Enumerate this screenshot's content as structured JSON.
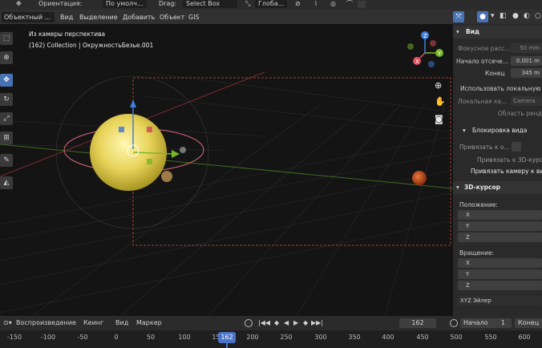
{
  "topbar": {
    "orientation_label": "Ориентация:",
    "orientation_value": "По умолч...",
    "drag_label": "Drag:",
    "drag_value": "Select Box",
    "transform_value": "Глоба..."
  },
  "header": {
    "mode": "Объектный ...",
    "menus": [
      "Вид",
      "Выделение",
      "Добавить",
      "Объект",
      "GIS"
    ]
  },
  "viewport": {
    "camera_text": "Из камеры перспектива",
    "collection_text": "(162) Collection | ОкружностьБезье.001",
    "gizmo": {
      "z": "Z",
      "y": "Y",
      "x": "X"
    }
  },
  "sidebar": {
    "view_panel": {
      "title": "Вид",
      "focal_label": "Фокусное расс...",
      "focal_value": "50 mm",
      "clip_start_label": "Начало отсече...",
      "clip_start_value": "0.001 m",
      "clip_end_label": "Конец",
      "clip_end_value": "345 m",
      "use_local_camera": "Использовать локальную к...",
      "local_camera_label": "Локальная ка...",
      "local_camera_value": "Camera",
      "render_region": "Область рендера"
    },
    "lock_panel": {
      "title": "Блокировка вида",
      "lock_to_object": "Привязать к о...",
      "lock_to_cursor": "Привязать к 3D-курсору",
      "lock_camera_to_view": "Привязать камеру к вид..."
    },
    "cursor_panel": {
      "title": "3D-курсор",
      "location_label": "Положение:",
      "rotation_label": "Вращение:",
      "axes": [
        "X",
        "Y",
        "Z"
      ],
      "euler_mode": "XYZ Эйлер"
    }
  },
  "playback": {
    "menus": [
      "Воспроизведение",
      "Кеинг",
      "Вид",
      "Маркер"
    ],
    "current_frame": "162",
    "start_label": "Начало",
    "start_value": "1",
    "end_label": "Конец"
  },
  "timeline": {
    "ticks": [
      "-150",
      "-100",
      "-50",
      "0",
      "50",
      "100",
      "150",
      "200",
      "250",
      "300",
      "350",
      "400",
      "450",
      "500",
      "550",
      "600"
    ],
    "current_frame": "162"
  },
  "colors": {
    "accent": "#4772b3",
    "playhead": "#4a74c9",
    "gizmo_x": "#e0505d",
    "gizmo_y": "#7ab82b",
    "gizmo_z": "#3f7fd9"
  },
  "icons": [
    "select-box-icon",
    "cursor-icon",
    "move-icon",
    "rotate-icon",
    "scale-icon",
    "transform-icon",
    "annotate-icon",
    "measure-icon",
    "zoom-icon",
    "hand-icon",
    "camera-icon"
  ]
}
